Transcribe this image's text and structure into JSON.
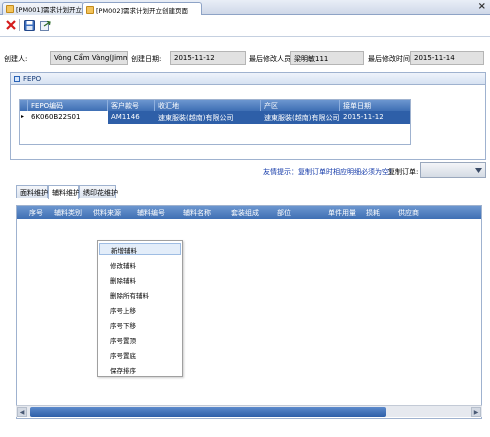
{
  "doc_tabs": [
    {
      "label": "[PM001]需求计划开立"
    },
    {
      "label": "[PM002]需求计划开立创建页面"
    }
  ],
  "window": {
    "close_label": "×"
  },
  "toolbar": {
    "delete_icon": "x-icon",
    "save_icon": "save-icon",
    "export_icon": "export-icon"
  },
  "header": {
    "creator_label": "创建人:",
    "creator_value": "Vòng Cẩm Vàng(Jimmy V",
    "created_date_label": "创建日期:",
    "created_date_value": "2015-11-12",
    "modifier_label": "最后修改人员:",
    "modifier_value": "梁明敏111",
    "modified_time_label": "最后修改时间:",
    "modified_time_value": "2015-11-14"
  },
  "fepo": {
    "title": "FEPO",
    "columns": [
      "FEPO编码",
      "客户款号",
      "收汇地",
      "产区",
      "接单日期"
    ],
    "rows": [
      {
        "marker": "▸",
        "fepo_code": "6K060B22S01",
        "customer_style": "AM1146",
        "remit_place": "速東服裝(越南)有限公司",
        "region": "速東服裝(越南)有限公司",
        "order_date": "2015-11-12"
      }
    ]
  },
  "hint": {
    "text": "友情提示：复制订单时相应明细必须为空！",
    "copy_order_label": "复制订单:"
  },
  "sub_tabs": [
    "面料维护",
    "辅料维护",
    "绣印花维护"
  ],
  "active_sub_tab": 1,
  "accessory_grid": {
    "columns": [
      "序号",
      "辅料类别",
      "供料来源",
      "辅料编号",
      "辅料名称",
      "套装组成",
      "部位",
      "单件用量",
      "损耗",
      "供应商"
    ]
  },
  "context_menu": {
    "items": [
      "新增辅料",
      "修改辅料",
      "删除辅料",
      "删除所有辅料",
      "序号上移",
      "序号下移",
      "序号置顶",
      "序号置底",
      "保存排序"
    ],
    "highlighted_index": 0
  },
  "colors": {
    "header_blue": "#3f6fb4",
    "selected_row": "#2e5fa8",
    "hint_blue": "#1238a8"
  }
}
